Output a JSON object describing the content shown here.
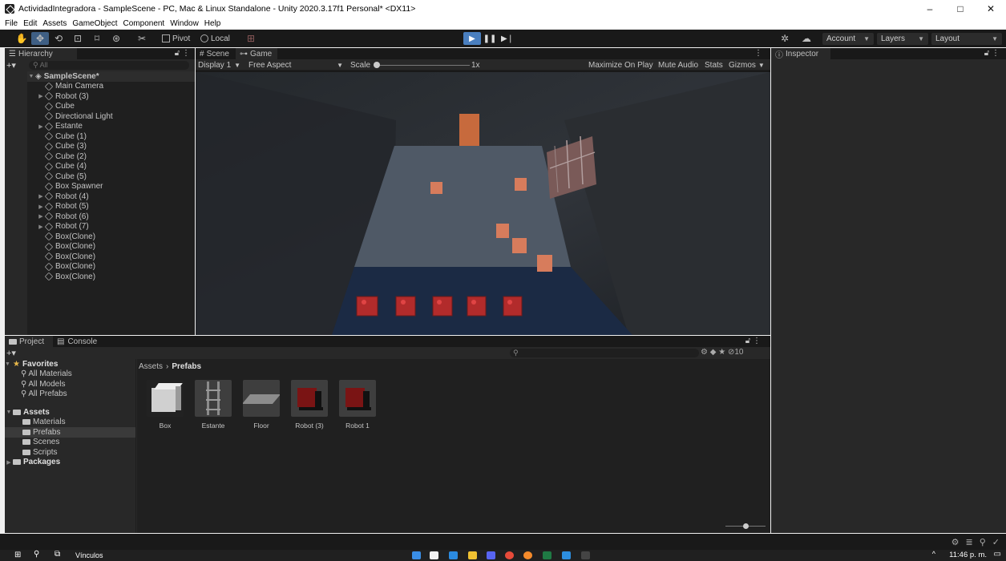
{
  "window": {
    "title": "ActividadIntegradora - SampleScene - PC, Mac & Linux Standalone - Unity 2020.3.17f1 Personal* <DX11>",
    "controls": [
      "–",
      "□",
      "✕"
    ]
  },
  "menu": [
    "File",
    "Edit",
    "Assets",
    "GameObject",
    "Component",
    "Window",
    "Help"
  ],
  "toolbar": {
    "pivot": "Pivot",
    "local": "Local",
    "account": "Account",
    "layers": "Layers",
    "layout": "Layout"
  },
  "hierarchy": {
    "tab": "Hierarchy",
    "search": "All",
    "scene": "SampleScene*",
    "items": [
      {
        "label": "Main Camera",
        "expandable": false
      },
      {
        "label": "Robot (3)",
        "expandable": true
      },
      {
        "label": "Cube",
        "expandable": false
      },
      {
        "label": "Directional Light",
        "expandable": false
      },
      {
        "label": "Estante",
        "expandable": true
      },
      {
        "label": "Cube (1)",
        "expandable": false
      },
      {
        "label": "Cube (3)",
        "expandable": false
      },
      {
        "label": "Cube (2)",
        "expandable": false
      },
      {
        "label": "Cube (4)",
        "expandable": false
      },
      {
        "label": "Cube (5)",
        "expandable": false
      },
      {
        "label": "Box Spawner",
        "expandable": false
      },
      {
        "label": "Robot (4)",
        "expandable": true
      },
      {
        "label": "Robot (5)",
        "expandable": true
      },
      {
        "label": "Robot (6)",
        "expandable": true
      },
      {
        "label": "Robot (7)",
        "expandable": true
      },
      {
        "label": "Box(Clone)",
        "expandable": false
      },
      {
        "label": "Box(Clone)",
        "expandable": false
      },
      {
        "label": "Box(Clone)",
        "expandable": false
      },
      {
        "label": "Box(Clone)",
        "expandable": false
      },
      {
        "label": "Box(Clone)",
        "expandable": false
      }
    ]
  },
  "game": {
    "tabs": [
      "Scene",
      "Game"
    ],
    "display": "Display 1",
    "aspect": "Free Aspect",
    "scale_label": "Scale",
    "scale_value": "1x",
    "right_items": [
      "Maximize On Play",
      "Mute Audio",
      "Stats",
      "Gizmos"
    ]
  },
  "inspector": {
    "tab": "Inspector"
  },
  "project": {
    "tabs": [
      "Project",
      "Console"
    ],
    "favorites": {
      "label": "Favorites",
      "items": [
        "All Materials",
        "All Models",
        "All Prefabs"
      ]
    },
    "assets": {
      "label": "Assets",
      "items": [
        "Materials",
        "Prefabs",
        "Scenes",
        "Scripts"
      ],
      "selected": "Prefabs"
    },
    "packages": "Packages",
    "breadcrumb": [
      "Assets",
      "Prefabs"
    ],
    "prefabs": [
      "Box",
      "Estante",
      "Floor",
      "Robot (3)",
      "Robot 1"
    ],
    "hidden_count": "10"
  },
  "taskbar": {
    "search_label": "Vínculos",
    "time": "11:46 p. m."
  }
}
